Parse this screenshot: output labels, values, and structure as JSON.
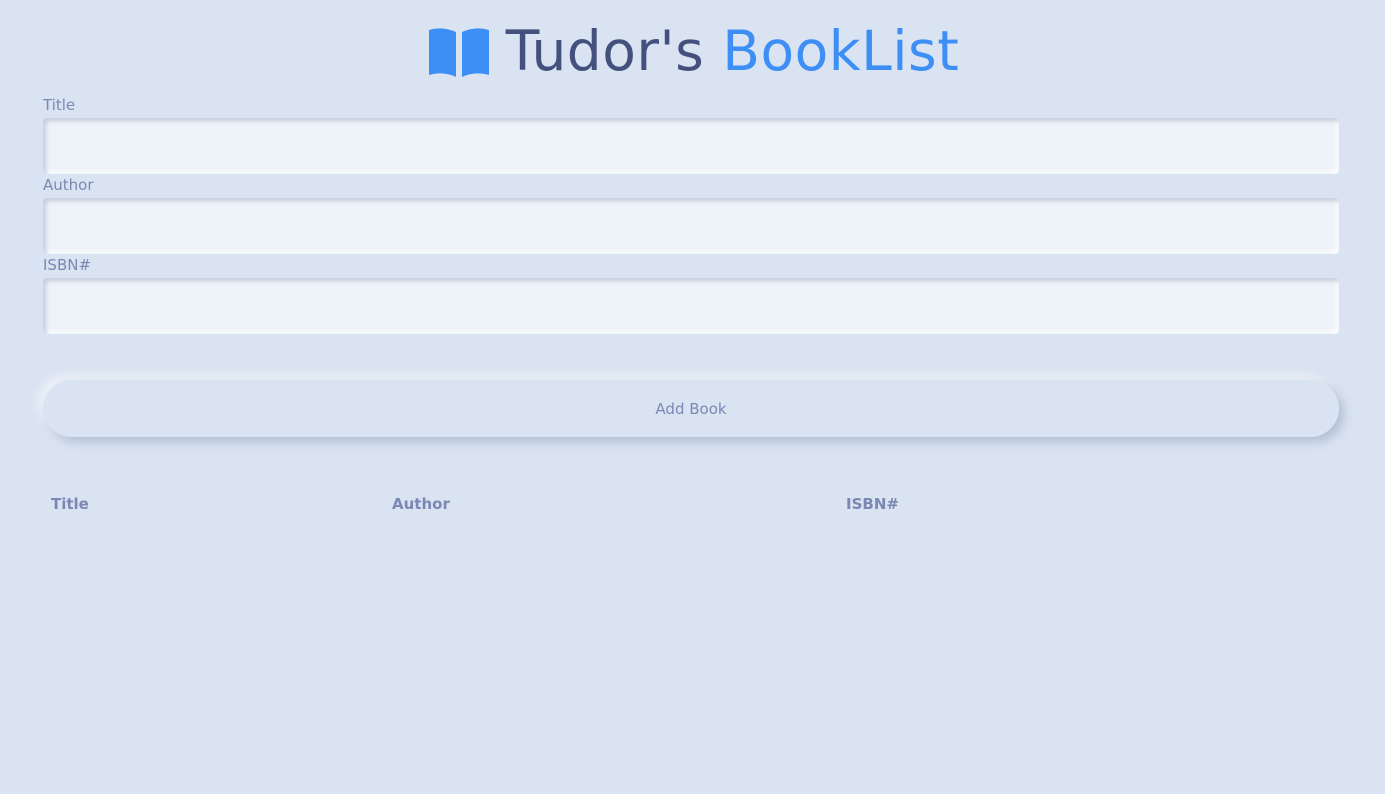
{
  "header": {
    "icon": "open-book-icon",
    "title_primary": "Tudor's",
    "title_accent": "BookList",
    "accent_color": "#3d8ef5"
  },
  "form": {
    "title_label": "Title",
    "title_value": "",
    "author_label": "Author",
    "author_value": "",
    "isbn_label": "ISBN#",
    "isbn_value": "",
    "submit_label": "Add Book"
  },
  "table": {
    "columns": [
      "Title",
      "Author",
      "ISBN#"
    ],
    "rows": []
  }
}
